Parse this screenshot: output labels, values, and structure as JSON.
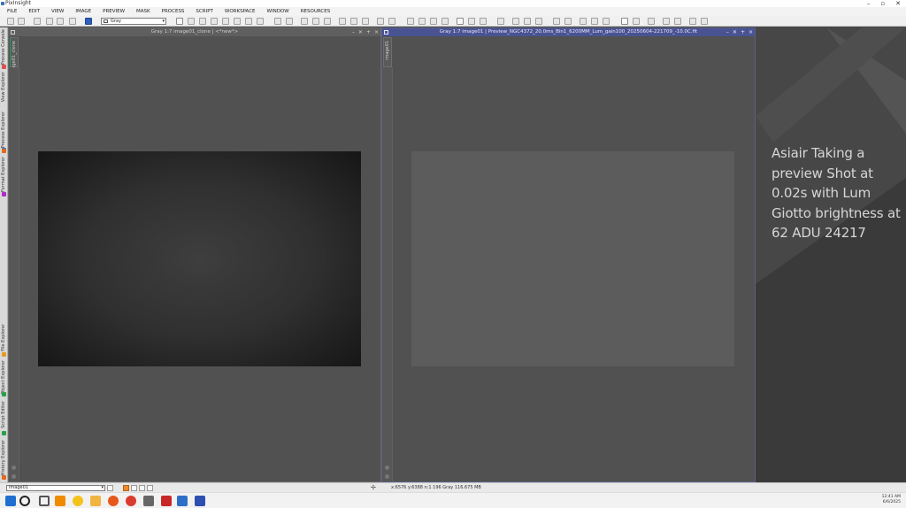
{
  "app": {
    "title": "PixInsight"
  },
  "menu": [
    "FILE",
    "EDIT",
    "VIEW",
    "IMAGE",
    "PREVIEW",
    "MASK",
    "PROCESS",
    "SCRIPT",
    "WORKSPACE",
    "WINDOW",
    "RESOURCES"
  ],
  "toolbar": {
    "colorspace_value": "Gray"
  },
  "left_dock": {
    "tabs": [
      {
        "label": "Process Console",
        "icon": "console-icon",
        "color": "#d9534f"
      },
      {
        "label": "View Explorer",
        "icon": "view-explorer-icon",
        "color": "#2d6ec9"
      },
      {
        "label": "Process Explorer",
        "icon": "process-explorer-icon",
        "color": "#e06a1e"
      },
      {
        "label": "Format Explorer",
        "icon": "format-explorer-icon",
        "color": "#b12bc8"
      },
      {
        "label": "File Explorer",
        "icon": "file-explorer-icon",
        "color": "#e39a24"
      },
      {
        "label": "Object Explorer",
        "icon": "object-explorer-icon",
        "color": "#2aa04a"
      },
      {
        "label": "Script Editor",
        "icon": "script-editor-icon",
        "color": "#2aa04a"
      },
      {
        "label": "History Explorer",
        "icon": "history-explorer-icon",
        "color": "#e06a1e"
      }
    ]
  },
  "window1": {
    "title": "Gray 1:7 image01_clone | <*new*>",
    "tab": "image01_clone"
  },
  "window2": {
    "title": "Gray 1:7 image01 | Preview_NGC4372_20.0ms_Bin1_6200MM_Lum_gain100_20250604-221709_-10.0C.fit",
    "tab": "image01"
  },
  "annotation_lines": [
    "Asiair Taking a",
    "preview Shot at",
    "0.02s with Lum",
    "Giotto brightness at",
    "62 ADU 24217"
  ],
  "statusbar": {
    "view_selector": "image01",
    "readout": "x:6576  y:6388  n:1  196  Gray  116.675 MB"
  },
  "taskbar": {
    "apps": [
      {
        "name": "start-icon",
        "color": "#1f6fd0"
      },
      {
        "name": "search-icon",
        "color": "#222222"
      },
      {
        "name": "task-view-icon",
        "color": "#555555"
      },
      {
        "name": "vlc-icon",
        "color": "#f08a00"
      },
      {
        "name": "sun-icon",
        "color": "#f5c21b"
      },
      {
        "name": "file-explorer-icon",
        "color": "#f2b441"
      },
      {
        "name": "firefox-icon",
        "color": "#e8571b"
      },
      {
        "name": "chrome-icon",
        "color": "#d93b2e"
      },
      {
        "name": "feather-icon",
        "color": "#666666"
      },
      {
        "name": "filezilla-icon",
        "color": "#c9262a"
      },
      {
        "name": "pixinsight-icon",
        "color": "#2d6ec9"
      },
      {
        "name": "vpn-icon",
        "color": "#2d4fb0"
      }
    ],
    "time": "12:41 AM",
    "date": "6/6/2025"
  },
  "colors": {
    "active_window_title": "#4a5392",
    "inactive_window_title": "#5f5f5f",
    "workspace_bg": "#4a4a4a"
  }
}
